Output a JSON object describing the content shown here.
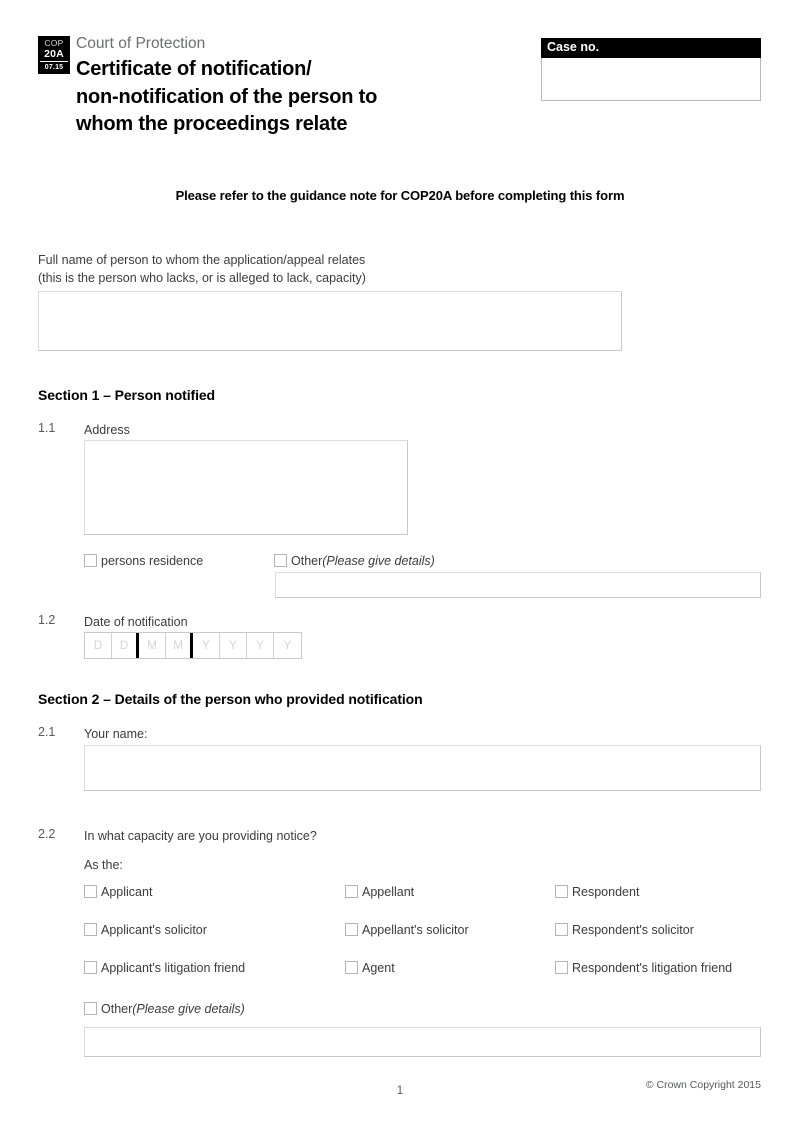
{
  "header": {
    "badge_org": "COP",
    "badge_form": "20A",
    "badge_version": "07.15",
    "court_name": "Court of Protection",
    "title_line1": "Certificate of notification/",
    "title_line2": "non-notification of the person to",
    "title_line3": "whom the proceedings relate"
  },
  "case_no": {
    "label": "Case no.",
    "value": ""
  },
  "guidance_note": "Please refer to the guidance note for COP20A before completing this form",
  "full_name": {
    "label_line1": "Full name of person to whom the application/appeal relates",
    "label_line2": "(this is the person who lacks, or is alleged to lack, capacity)",
    "value": ""
  },
  "section1": {
    "heading": "Section 1 – Person notified",
    "q1_1": {
      "number": "1.1",
      "label": "Address",
      "address_value": "",
      "checkbox_residence": "persons residence",
      "checkbox_other": "Other",
      "checkbox_other_hint": "(Please give details)",
      "other_value": ""
    },
    "q1_2": {
      "number": "1.2",
      "label": "Date of notification",
      "cells": [
        "D",
        "D",
        "M",
        "M",
        "Y",
        "Y",
        "Y",
        "Y"
      ]
    }
  },
  "section2": {
    "heading": "Section 2 – Details of the person who provided notification",
    "q2_1": {
      "number": "2.1",
      "label": "Your name:",
      "value": ""
    },
    "q2_2": {
      "number": "2.2",
      "label": "In what capacity are you providing notice?",
      "sublabel": "As the:",
      "rows": [
        {
          "col1": "Applicant",
          "col2": "Appellant",
          "col3": "Respondent"
        },
        {
          "col1": "Applicant's solicitor",
          "col2": "Appellant's solicitor",
          "col3": "Respondent's solicitor"
        },
        {
          "col1": "Applicant's litigation friend",
          "col2": "Agent",
          "col3": "Respondent's litigation friend"
        }
      ],
      "checkbox_other": "Other",
      "checkbox_other_hint": "(Please give details)",
      "other_value": ""
    }
  },
  "footer": {
    "page_number": "1",
    "copyright": "© Crown Copyright 2015"
  },
  "colors": {
    "ink": "#231f20",
    "muted": "#6d6e71",
    "border": "#c9c9c9",
    "bar": "#000000"
  }
}
